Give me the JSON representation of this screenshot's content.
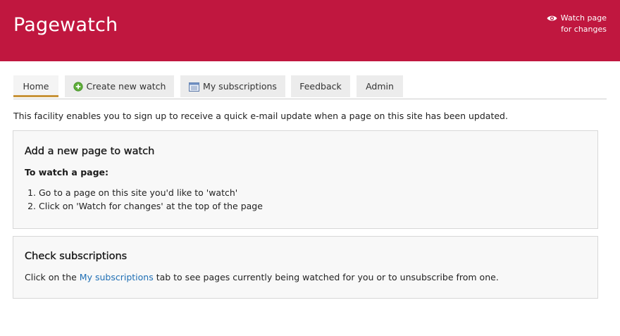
{
  "header": {
    "title": "Pagewatch",
    "watch_line1": "Watch page",
    "watch_line2": "for changes",
    "brand_color": "#c0173f"
  },
  "tabs": [
    {
      "label": "Home",
      "active": true
    },
    {
      "label": "Create new watch",
      "icon": "plus-circle-icon"
    },
    {
      "label": "My subscriptions",
      "icon": "calendar-list-icon"
    },
    {
      "label": "Feedback"
    },
    {
      "label": "Admin"
    }
  ],
  "intro": "This facility enables you to sign up to receive a quick e-mail update when a page on this site has been updated.",
  "panel_add": {
    "title": "Add a new page to watch",
    "subtitle": "To watch a page:",
    "steps": [
      "Go to a page on this site you'd like to 'watch'",
      "Click on 'Watch for changes' at the top of the page"
    ]
  },
  "panel_check": {
    "title": "Check subscriptions",
    "text_before": "Click on the ",
    "link_text": "My subscriptions",
    "text_after": " tab to see pages currently being watched for you or to unsubscribe from one."
  }
}
